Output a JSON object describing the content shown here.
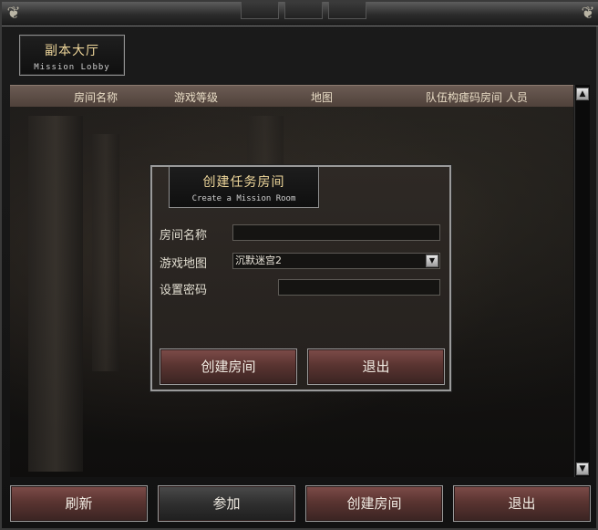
{
  "window": {
    "title_cn": "副本大厅",
    "title_en": "Mission Lobby"
  },
  "list_header": {
    "room_name": "房间名称",
    "game_level": "游戏等级",
    "map": "地图",
    "team_password_room_members": "队伍构瘧码房间 人员"
  },
  "bottom_buttons": {
    "refresh": "刷新",
    "join": "参加",
    "create_room": "创建房间",
    "exit": "退出"
  },
  "dialog": {
    "title_cn": "创建任务房间",
    "title_en": "Create a Mission Room",
    "room_name_label": "房间名称",
    "room_name_value": "",
    "map_label": "游戏地图",
    "map_value": "沉默迷宫2",
    "password_label": "设置密码",
    "password_value": "",
    "create_button": "创建房间",
    "exit_button": "退出"
  },
  "icons": {
    "corner_left": "ornament-left-icon",
    "corner_right": "ornament-right-icon",
    "scroll_up": "arrow-up-icon",
    "scroll_down": "arrow-down-icon",
    "dropdown": "chevron-down-icon"
  },
  "colors": {
    "title_gold": "#efd79b",
    "button_red": "#5a3431",
    "header_brown": "#5e4d45"
  }
}
